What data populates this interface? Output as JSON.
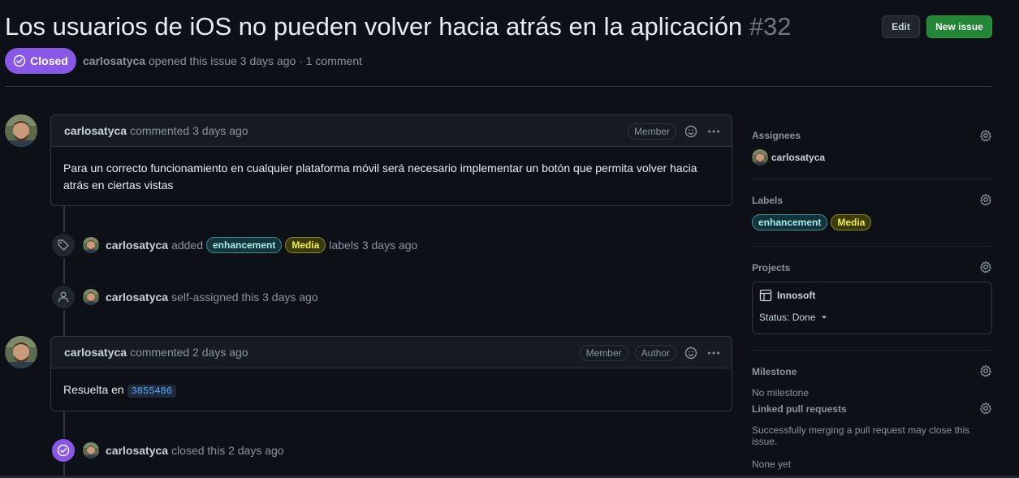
{
  "issue": {
    "title": "Los usuarios de iOS no pueden volver hacia atrás en la aplicación",
    "number": "#32",
    "state": "Closed",
    "author": "carlosatyca",
    "meta": "opened this issue 3 days ago · 1 comment"
  },
  "header": {
    "edit_label": "Edit",
    "new_issue_label": "New issue"
  },
  "comments": [
    {
      "author": "carlosatyca",
      "when": "commented 3 days ago",
      "roles": [
        "Member"
      ],
      "body": "Para un correcto funcionamiento en cualquier plataforma móvil será necesario implementar un botón que permita volver hacia atrás en ciertas vistas"
    },
    {
      "author": "carlosatyca",
      "when": "commented 2 days ago",
      "roles": [
        "Member",
        "Author"
      ],
      "body_prefix": "Resuelta en",
      "commit": "3855486"
    }
  ],
  "events": {
    "labeled": {
      "actor": "carlosatyca",
      "verb": "added",
      "labels": [
        "enhancement",
        "Media"
      ],
      "suffix": "labels 3 days ago"
    },
    "assigned": {
      "actor": "carlosatyca",
      "text": "self-assigned this 3 days ago"
    },
    "closed": {
      "actor": "carlosatyca",
      "text": "closed this 2 days ago"
    }
  },
  "sidebar": {
    "assignees": {
      "title": "Assignees",
      "user": "carlosatyca"
    },
    "labels": {
      "title": "Labels",
      "items": [
        "enhancement",
        "Media"
      ]
    },
    "projects": {
      "title": "Projects",
      "name": "Innosoft",
      "status": "Status: Done"
    },
    "milestone": {
      "title": "Milestone",
      "value": "No milestone"
    },
    "linked": {
      "title": "Linked pull requests",
      "description": "Successfully merging a pull request may close this issue.",
      "value": "None yet"
    }
  },
  "colors": {
    "background": "#0d1117",
    "closed": "#8957e5",
    "new_issue": "#238636",
    "enhancement": "#a2eeef",
    "media": "#f1f132"
  }
}
